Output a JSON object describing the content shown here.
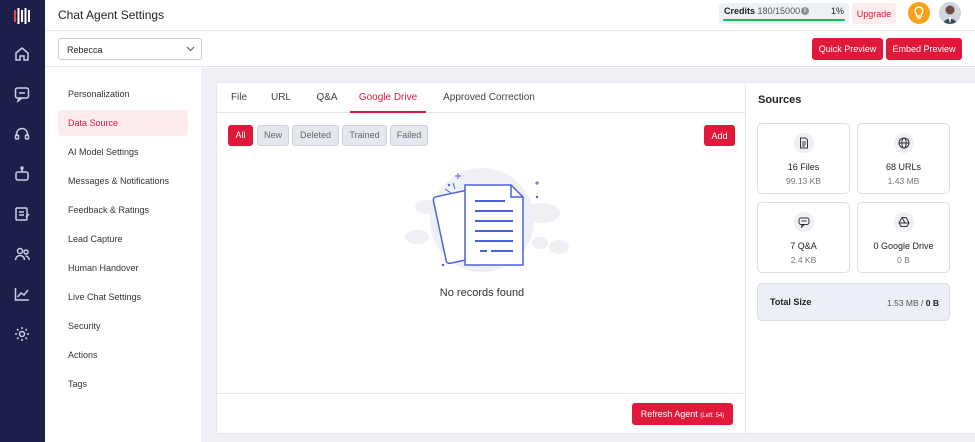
{
  "header": {
    "title": "Chat Agent Settings",
    "credits_label": "Credits",
    "credits_value": "180/15000",
    "credits_percent": "1%",
    "upgrade_label": "Upgrade"
  },
  "toolbar": {
    "agent_selected": "Rebecca",
    "quick_preview_label": "Quick Preview",
    "embed_preview_label": "Embed Preview"
  },
  "nav": {
    "items": [
      "Personalization",
      "Data Source",
      "AI Model Settings",
      "Messages & Notifications",
      "Feedback & Ratings",
      "Lead Capture",
      "Human Handover",
      "Live Chat Settings",
      "Security",
      "Actions",
      "Tags"
    ],
    "active": "Data Source"
  },
  "tabs": [
    "File",
    "URL",
    "Q&A",
    "Google Drive",
    "Approved Correction"
  ],
  "active_tab": "Google Drive",
  "filters": [
    "All",
    "New",
    "Deleted",
    "Trained",
    "Failed"
  ],
  "active_filter": "All",
  "add_label": "Add",
  "empty_text": "No records found",
  "refresh": {
    "label": "Refresh Agent",
    "left": "(Left: 54)"
  },
  "sources": {
    "title": "Sources",
    "cards": [
      {
        "icon": "file-icon",
        "title": "16 Files",
        "size": "99.13 KB"
      },
      {
        "icon": "globe-icon",
        "title": "68 URLs",
        "size": "1.43 MB"
      },
      {
        "icon": "qa-chat-icon",
        "title": "7 Q&A",
        "size": "2.4 KB"
      },
      {
        "icon": "google-drive-icon",
        "title": "0 Google Drive",
        "size": "0 B"
      }
    ],
    "total_label": "Total Size",
    "total_used": "1.53 MB /",
    "total_limit": "0 B"
  },
  "colors": {
    "accent": "#e0193a",
    "rail": "#1c1f4a",
    "success": "#18b85b"
  }
}
